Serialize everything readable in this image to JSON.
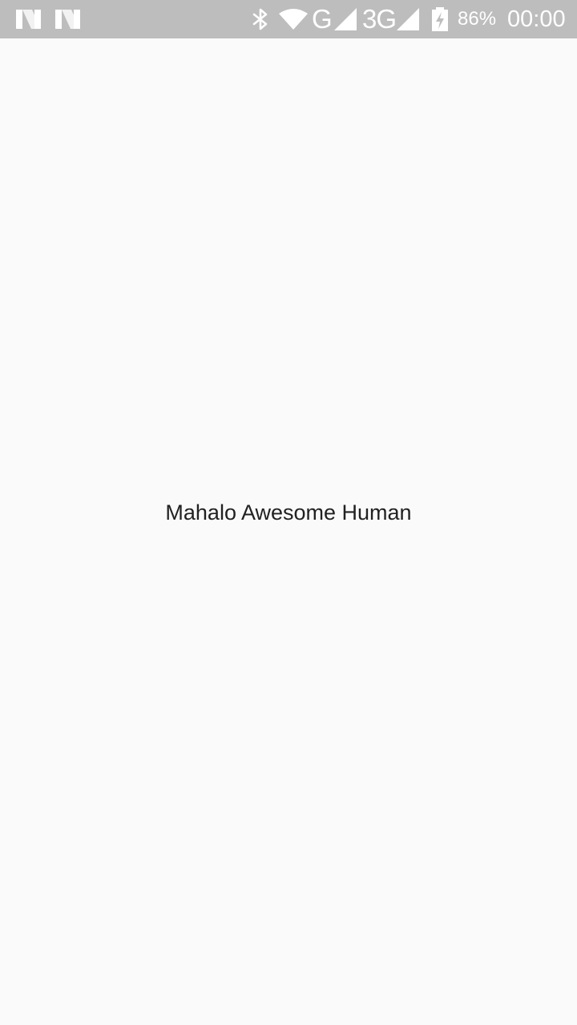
{
  "status_bar": {
    "background": "#bdbdbd",
    "left_icons": [
      "notification-n-icon",
      "notification-n-icon"
    ],
    "right_icons": [
      "bluetooth-icon",
      "wifi-icon",
      "cell-signal-icon",
      "cell-signal-icon",
      "battery-charging-icon"
    ],
    "network_1": "G",
    "network_2": "3G",
    "battery": "86%",
    "time": "00:00"
  },
  "main": {
    "message": "Mahalo Awesome Human",
    "background": "#fafafa",
    "text_color": "#212121"
  }
}
